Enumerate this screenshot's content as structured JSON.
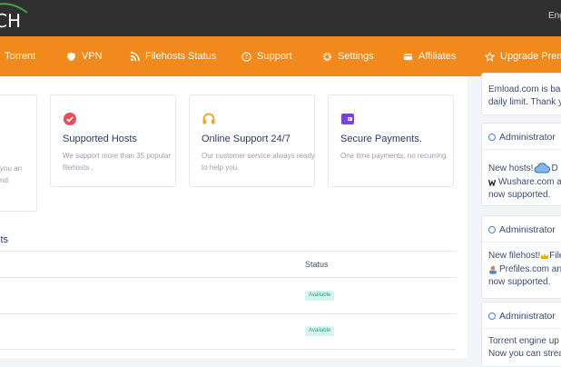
{
  "header": {
    "language": "Eng"
  },
  "nav": {
    "items": [
      {
        "label": "Torrent"
      },
      {
        "label": "VPN",
        "icon": "shield-icon"
      },
      {
        "label": "Filehosts Status",
        "icon": "rss-icon"
      },
      {
        "label": "Support",
        "icon": "question-icon"
      },
      {
        "label": "Settings",
        "icon": "gear-icon"
      },
      {
        "label": "Affiliates",
        "icon": "card-icon"
      },
      {
        "label": "Upgrade Prem",
        "icon": "star-icon"
      }
    ]
  },
  "cards": [
    {
      "partial_text": [
        "you an",
        "nd"
      ]
    },
    {
      "title": "Supported Hosts",
      "text": "We support more than 35 popular filehosts .",
      "icon": "check-badge-icon",
      "color": "#e84b5a"
    },
    {
      "title": "Online Support 24/7",
      "text": "Our customer service always ready to help you.",
      "icon": "headset-icon",
      "color": "#f3a514"
    },
    {
      "title": "Secure Payments.",
      "text": "One time payments, no recurring.",
      "icon": "wallet-icon",
      "color": "#7a42d6"
    }
  ],
  "table": {
    "section_title": "sts",
    "status_header": "Status",
    "rows": [
      {
        "status": "Available"
      },
      {
        "status": "Available"
      }
    ]
  },
  "sidebar": {
    "card1": [
      "Emload.com is ba",
      "daily limit. Thank y"
    ],
    "posts": [
      {
        "author": "Administrator",
        "lines": [
          "New hosts! ",
          " D",
          "Wushare.com a",
          "now supported."
        ]
      },
      {
        "author": "Administrator",
        "lines": [
          "New filehost!",
          " File",
          "Prefiles.com an",
          "now supported."
        ]
      },
      {
        "author": "Administrator",
        "lines": [
          "Torrent engine up",
          "Now you can strea"
        ]
      }
    ]
  },
  "colors": {
    "accent": "#f2891d",
    "topbar": "#2f2f2f",
    "badge_bg": "#d7f5ee",
    "badge_text": "#1fa98a"
  }
}
